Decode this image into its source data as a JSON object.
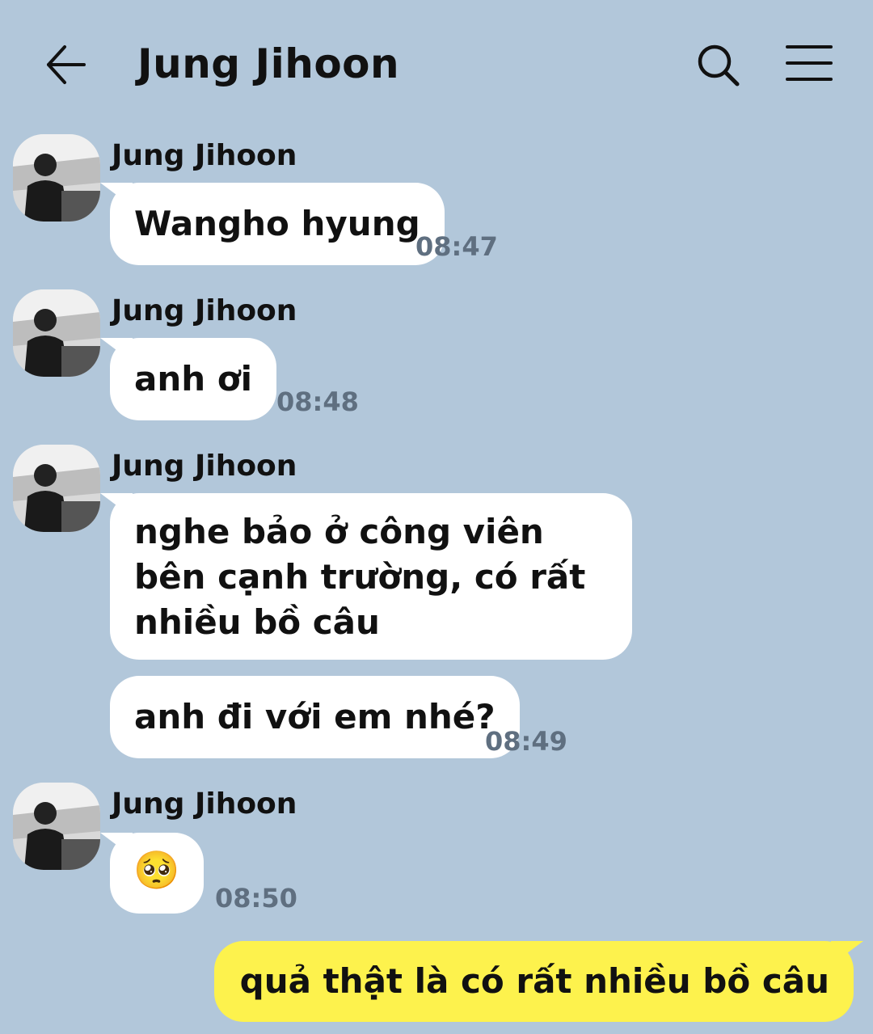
{
  "header": {
    "title": "Jung Jihoon",
    "back_icon": "arrow-left-icon",
    "search_icon": "search-icon",
    "menu_icon": "hamburger-menu-icon"
  },
  "messages": [
    {
      "sender": "Jung Jihoon",
      "text": "Wangho hyung",
      "time": "08:47"
    },
    {
      "sender": "Jung Jihoon",
      "text": "anh ơi",
      "time": "08:48"
    },
    {
      "sender": "Jung Jihoon",
      "text": "nghe bảo ở công viên bên cạnh trường, có rất nhiều bồ câu",
      "time": ""
    },
    {
      "sender": "",
      "text": "anh đi với em nhé?",
      "time": "08:49"
    },
    {
      "sender": "Jung Jihoon",
      "text": "🥺",
      "time": "08:50"
    },
    {
      "sender": "me",
      "text": "quả thật là có rất nhiều bồ câu",
      "time": ""
    }
  ],
  "colors": {
    "background": "#b2c7da",
    "incoming_bubble": "#ffffff",
    "outgoing_bubble": "#fdf24d",
    "timestamp": "#5f6f80"
  }
}
